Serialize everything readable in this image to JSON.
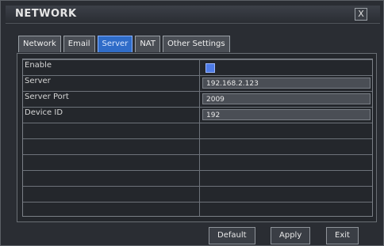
{
  "window": {
    "title": "NETWORK",
    "close_glyph": "X"
  },
  "tabs": [
    {
      "label": "Network",
      "active": false
    },
    {
      "label": "Email",
      "active": false
    },
    {
      "label": "Server",
      "active": true
    },
    {
      "label": "NAT",
      "active": false
    },
    {
      "label": "Other Settings",
      "active": false
    }
  ],
  "form": {
    "rows": [
      {
        "label": "Enable",
        "type": "checkbox",
        "checked": true
      },
      {
        "label": "Server",
        "type": "text",
        "value": "192.168.2.123"
      },
      {
        "label": "Server Port",
        "type": "text",
        "value": "2009"
      },
      {
        "label": "Device ID",
        "type": "text",
        "value": "192"
      }
    ],
    "total_rows": 10
  },
  "buttons": {
    "default": "Default",
    "apply": "Apply",
    "exit": "Exit"
  },
  "icons": {
    "close": "close-icon",
    "checkbox": "checkbox-checked-icon"
  },
  "colors": {
    "accent": "#2f6cc8",
    "checkbox": "#4e7be6"
  }
}
